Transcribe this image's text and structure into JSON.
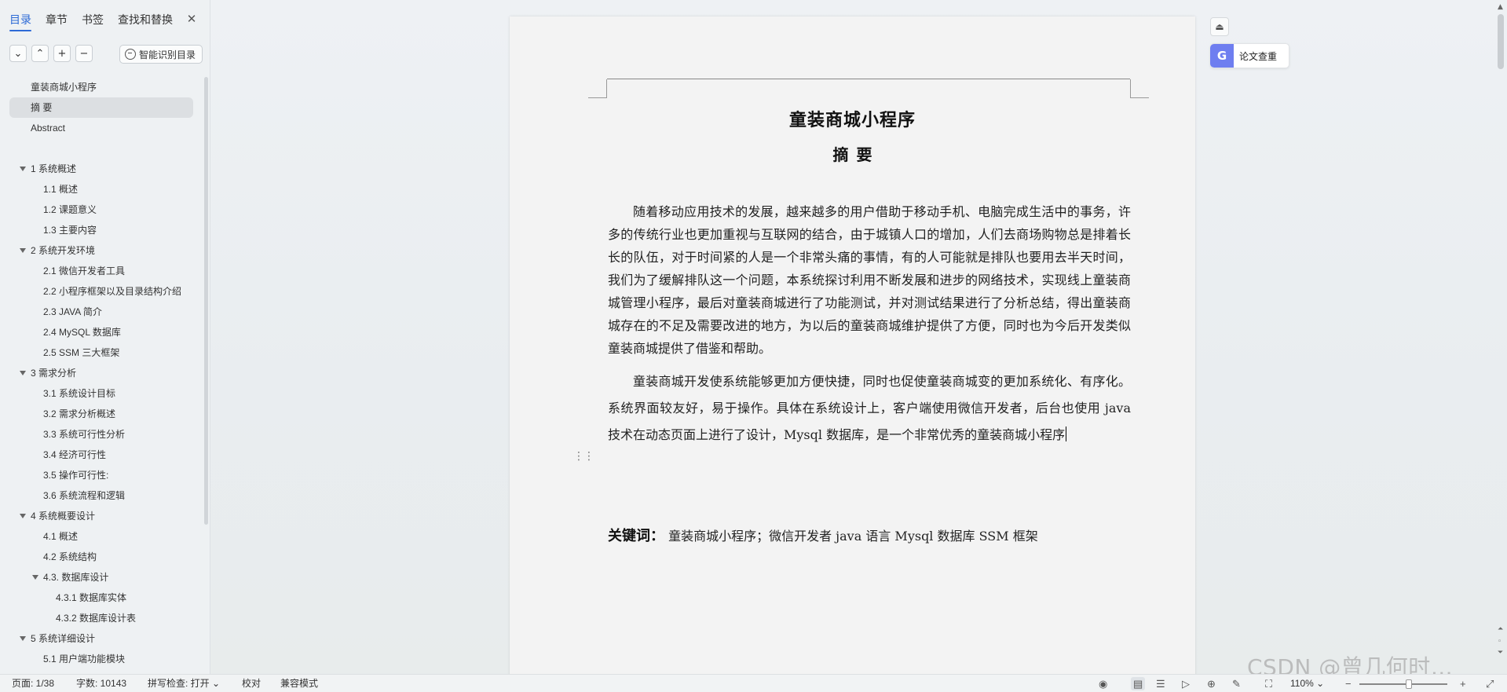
{
  "nav": {
    "tabs": [
      "目录",
      "章节",
      "书签",
      "查找和替换"
    ],
    "close_glyph": "✕",
    "tools": [
      "⌄",
      "⌃",
      "+",
      "−"
    ],
    "smart_label": "智能识别目录"
  },
  "toc": [
    {
      "label": "童装商城小程序",
      "level": 0,
      "expand": false,
      "selected": false
    },
    {
      "label": "摘 要",
      "level": 0,
      "expand": false,
      "selected": true
    },
    {
      "label": "Abstract",
      "level": 0,
      "expand": false,
      "selected": false
    },
    {
      "label": "",
      "gap": true
    },
    {
      "label": "1  系统概述",
      "level": 0,
      "expand": true
    },
    {
      "label": "1.1  概述",
      "level": 1
    },
    {
      "label": "1.2 课题意义",
      "level": 1
    },
    {
      "label": "1.3  主要内容",
      "level": 1
    },
    {
      "label": "2  系统开发环境",
      "level": 0,
      "expand": true
    },
    {
      "label": "2.1 微信开发者工具",
      "level": 1
    },
    {
      "label": "2.2 小程序框架以及目录结构介绍",
      "level": 1
    },
    {
      "label": "2.3 JAVA 简介",
      "level": 1
    },
    {
      "label": "2.4 MySQL 数据库",
      "level": 1
    },
    {
      "label": "2.5 SSM 三大框架",
      "level": 1
    },
    {
      "label": "3  需求分析",
      "level": 0,
      "expand": true
    },
    {
      "label": "3.1  系统设计目标",
      "level": 1
    },
    {
      "label": "3.2 需求分析概述",
      "level": 1
    },
    {
      "label": "3.3  系统可行性分析",
      "level": 1
    },
    {
      "label": "3.4 经济可行性",
      "level": 1
    },
    {
      "label": "3.5 操作可行性:",
      "level": 1
    },
    {
      "label": "3.6 系统流程和逻辑",
      "level": 1
    },
    {
      "label": "4 系统概要设计",
      "level": 0,
      "expand": true
    },
    {
      "label": "4.1  概述",
      "level": 1
    },
    {
      "label": "4.2  系统结构",
      "level": 1
    },
    {
      "label": "4.3.  数据库设计",
      "level": 1,
      "expand": true
    },
    {
      "label": "4.3.1  数据库实体",
      "level": 2
    },
    {
      "label": "4.3.2  数据库设计表",
      "level": 2
    },
    {
      "label": "5 系统详细设计",
      "level": 0,
      "expand": true
    },
    {
      "label": "5.1 用户端功能模块",
      "level": 1
    }
  ],
  "document": {
    "title": "童装商城小程序",
    "subtitle": "摘要",
    "paragraph1": "随着移动应用技术的发展，越来越多的用户借助于移动手机、电脑完成生活中的事务，许多的传统行业也更加重视与互联网的结合，由于城镇人口的增加，人们去商场购物总是排着长长的队伍，对于时间紧的人是一个非常头痛的事情，有的人可能就是排队也要用去半天时间，我们为了缓解排队这一个问题，本系统探讨利用不断发展和进步的网络技术，实现线上童装商城管理小程序，最后对童装商城进行了功能测试，并对测试结果进行了分析总结，得出童装商城存在的不足及需要改进的地方，为以后的童装商城维护提供了方便，同时也为今后开发类似童装商城提供了借鉴和帮助。",
    "paragraph2": "童装商城开发使系统能够更加方便快捷，同时也促使童装商城变的更加系统化、有序化。系统界面较友好，易于操作。具体在系统设计上，客户端使用微信开发者，后台也使用 java 技术在动态页面上进行了设计，Mysql 数据库，是一个非常优秀的童装商城小程序",
    "keywords_label": "关键词：",
    "keywords": "童装商城小程序；微信开发者  java 语言   Mysql  数据库  SSM 框架"
  },
  "side_tools": {
    "collapse_glyph": "⏏",
    "check_label": "论文查重",
    "check_glyph": "G"
  },
  "status": {
    "page": "页面: 1/38",
    "words": "字数: 10143",
    "spell": "拼写检查: 打开",
    "spell_arrow": "⌄",
    "proof": "校对",
    "compat": "兼容模式",
    "zoom": "110%",
    "zoom_arrow": "⌄"
  },
  "watermark": "CSDN @曾几何时…"
}
